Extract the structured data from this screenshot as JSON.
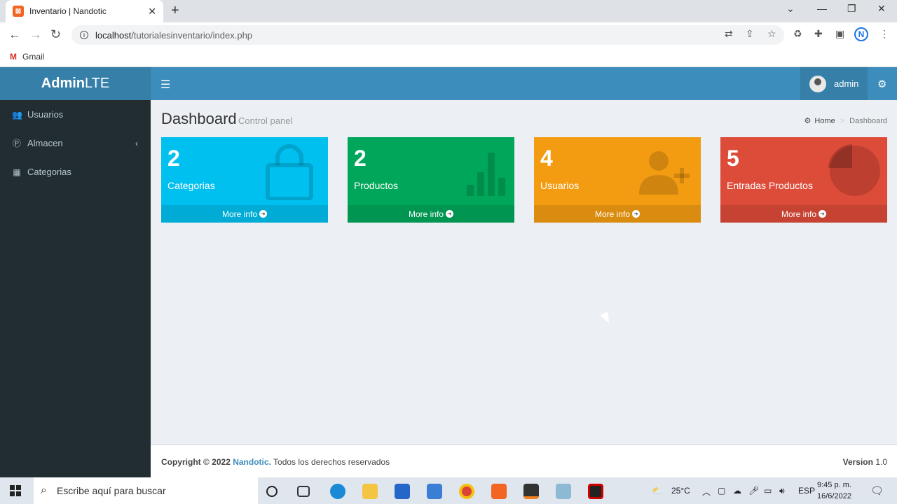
{
  "browser": {
    "tab_title": "Inventario | Nandotic",
    "url_host": "localhost",
    "url_path": "/tutorialesinventario/index.php",
    "bookmark": "Gmail",
    "profile_initial": "N"
  },
  "app": {
    "logo_bold": "Admin",
    "logo_rest": "LTE",
    "user": "admin"
  },
  "sidebar": {
    "items": [
      {
        "label": "Usuarios",
        "icon": "users-icon"
      },
      {
        "label": "Almacen",
        "icon": "product-hunt-icon"
      },
      {
        "label": "Categorias",
        "icon": "th-icon"
      }
    ]
  },
  "page": {
    "title": "Dashboard",
    "subtitle": "Control panel",
    "breadcrumb": [
      "Home",
      "Dashboard"
    ]
  },
  "boxes": [
    {
      "value": "2",
      "label": "Categorias",
      "more": "More info",
      "color": "#00c0ef",
      "icon": "shopping-bag-icon"
    },
    {
      "value": "2",
      "label": "Productos",
      "more": "More info",
      "color": "#00a65a",
      "icon": "bar-chart-icon"
    },
    {
      "value": "4",
      "label": "Usuarios",
      "more": "More info",
      "color": "#f39c12",
      "icon": "user-plus-icon"
    },
    {
      "value": "5",
      "label": "Entradas Productos",
      "more": "More info",
      "color": "#dd4b39",
      "icon": "pie-chart-icon"
    }
  ],
  "footer": {
    "copyright": "Copyright © 2022",
    "brand": "Nandotic.",
    "rights": "Todos los derechos reservados",
    "version_label": "Version",
    "version": "1.0"
  },
  "taskbar": {
    "search_placeholder": "Escribe aquí para buscar",
    "temperature": "25°C",
    "language": "ESP",
    "time": "9:45 p. m.",
    "date": "16/6/2022"
  }
}
